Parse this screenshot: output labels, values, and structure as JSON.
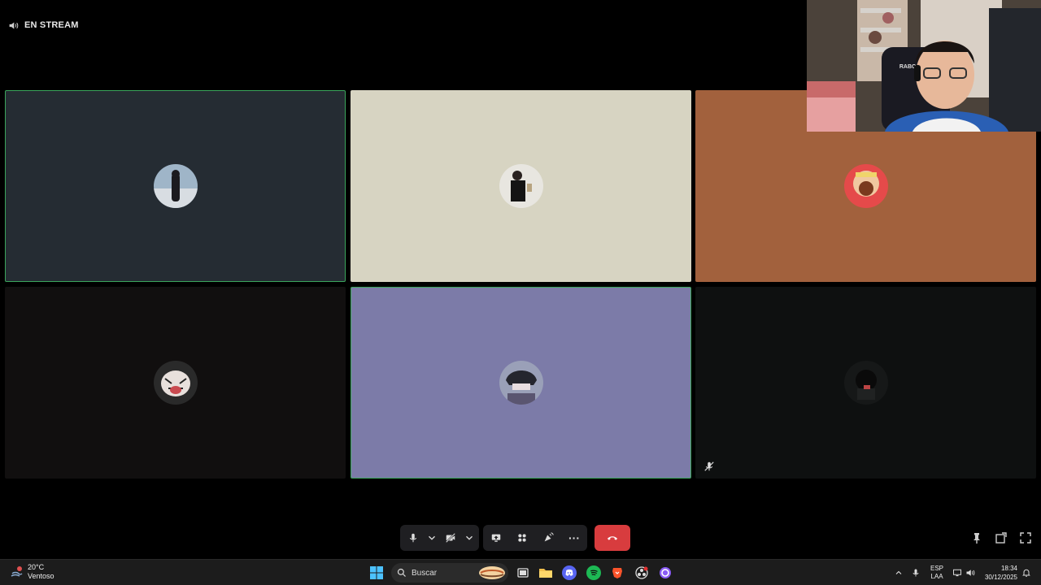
{
  "stream_label": "EN STREAM",
  "participants": [
    {
      "id": "p1",
      "bg": "#252c33",
      "speaking": true
    },
    {
      "id": "p2",
      "bg": "#d7d4c2",
      "speaking": false
    },
    {
      "id": "p3",
      "bg": "#a2613d",
      "speaking": false
    },
    {
      "id": "p4",
      "bg": "#110f0f",
      "speaking": false
    },
    {
      "id": "p5",
      "bg": "#7c7ba8",
      "speaking": true
    },
    {
      "id": "p6",
      "bg": "#0e1010",
      "speaking": false,
      "muted": true
    }
  ],
  "webcam": {
    "chair_text": "RABOATIET"
  },
  "controls": {
    "mic": "microphone-icon",
    "camera": "camera-off-icon",
    "share": "screen-share-icon",
    "activities": "activities-icon",
    "soundboard": "soundboard-icon",
    "more": "···",
    "leave": "hang-up-icon"
  },
  "taskbar": {
    "weather_temp": "20°C",
    "weather_desc": "Ventoso",
    "search_placeholder": "Buscar",
    "lang_1": "ESP",
    "lang_2": "LAA",
    "time": "18:34",
    "date": "30/12/2025"
  },
  "colors": {
    "speaking_border": "#3ba55c",
    "leave_button": "#d83c3e",
    "taskbar_bg": "#1c1c1c"
  }
}
